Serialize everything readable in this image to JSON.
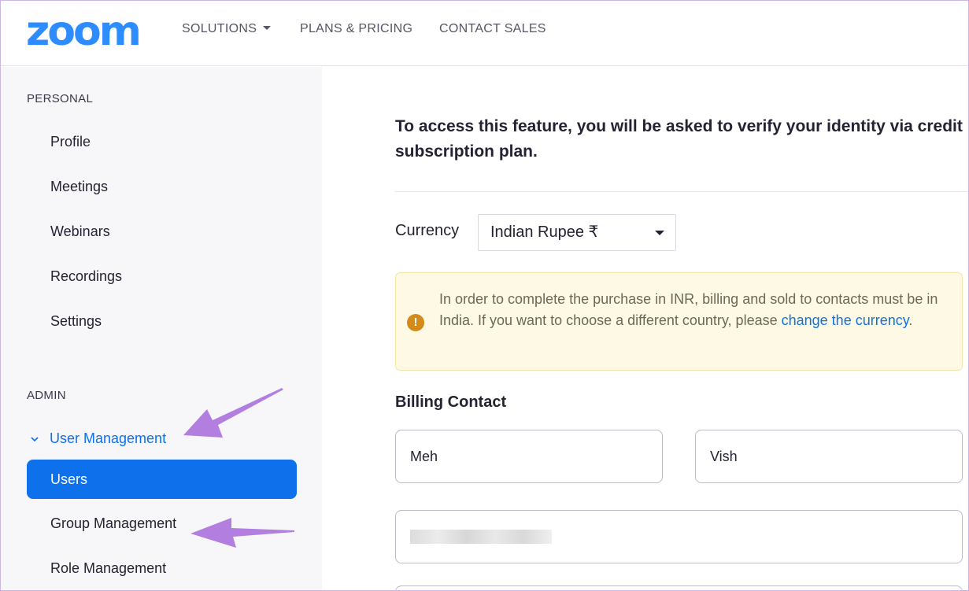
{
  "header": {
    "logo": "zoom",
    "nav": [
      {
        "label": "SOLUTIONS",
        "has_dropdown": true
      },
      {
        "label": "PLANS & PRICING"
      },
      {
        "label": "CONTACT SALES"
      }
    ]
  },
  "sidebar": {
    "personal_title": "PERSONAL",
    "personal_items": [
      "Profile",
      "Meetings",
      "Webinars",
      "Recordings",
      "Settings"
    ],
    "admin_title": "ADMIN",
    "admin_group": "User Management",
    "admin_active": "Users",
    "admin_items": [
      "Group Management",
      "Role Management"
    ]
  },
  "main": {
    "heading": "To access this feature, you will be asked to verify your identity via credit subscription plan.",
    "heading_line1": "To access this feature, you will be asked to verify your identity via credit",
    "heading_line2": "subscription plan.",
    "currency_label": "Currency",
    "currency_value": "Indian Rupee ₹",
    "notice_text": "In order to complete the purchase in INR, billing and sold to contacts must be in India. If you want to choose a different country, please",
    "notice_link": "change the currency",
    "notice_end": ".",
    "billing_title": "Billing Contact",
    "first_name": "Meh",
    "last_name": "Vish"
  },
  "colors": {
    "brand": "#2d8cff",
    "active": "#0e71eb",
    "notice_bg": "#fdf9e5",
    "warning": "#d48a19",
    "annotation_arrow": "#b27fe0"
  },
  "icons": [
    "caret-down-icon",
    "chevron-down-icon",
    "warning-icon",
    "annotation-arrow"
  ]
}
